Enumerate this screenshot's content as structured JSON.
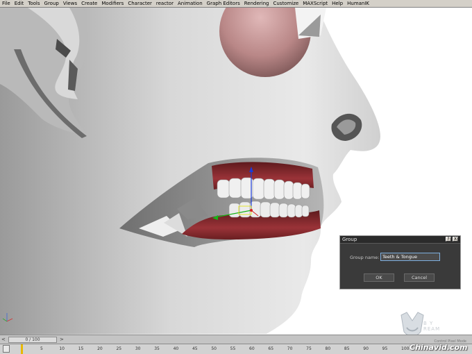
{
  "menu": [
    "File",
    "Edit",
    "Tools",
    "Group",
    "Views",
    "Create",
    "Modifiers",
    "Character",
    "reactor",
    "Animation",
    "Graph Editors",
    "Rendering",
    "Customize",
    "MAXScript",
    "Help",
    "HumanIK"
  ],
  "dialog": {
    "title": "Group",
    "help_btn": "?",
    "close_btn": "X",
    "group_name_label": "Group name:",
    "group_name_value": "Teeth & Tongue",
    "ok_label": "OK",
    "cancel_label": "Cancel"
  },
  "timeline": {
    "frame_counter": "0 / 100",
    "ticks": [
      "5",
      "10",
      "15",
      "20",
      "25",
      "30",
      "35",
      "40",
      "45",
      "50",
      "55",
      "60",
      "65",
      "70",
      "75",
      "80",
      "85",
      "90",
      "95",
      "100"
    ],
    "left_arrow": "<",
    "right_arrow": ">"
  },
  "status_caption": "Control Pixel Mode",
  "logo": {
    "line1": "B Y",
    "line2": "REAM"
  },
  "watermark": "Chinavid.com",
  "colors": {
    "menu_bg": "#d4d0c8",
    "dialog_bg": "#3a3a3a",
    "gums": "#8c2a2e",
    "teeth": "#eeeeee",
    "accent_input": "#7fb0e0",
    "time_marker": "#e8b800"
  }
}
